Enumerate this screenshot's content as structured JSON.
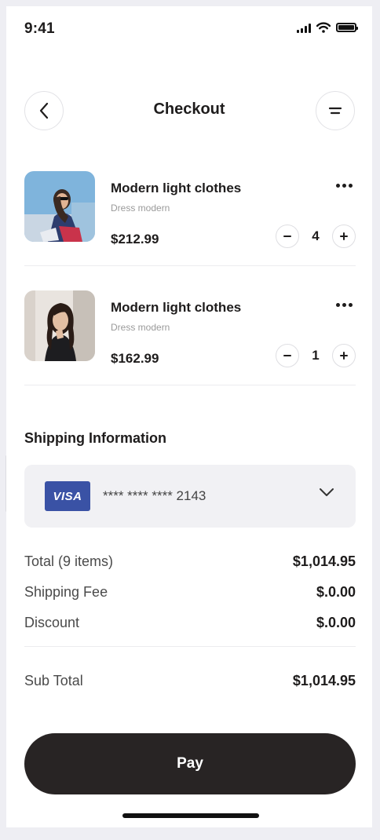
{
  "status_bar": {
    "time": "9:41"
  },
  "header": {
    "title": "Checkout"
  },
  "items": [
    {
      "name": "Modern light clothes",
      "subtitle": "Dress modern",
      "price": "$212.99",
      "quantity": "4"
    },
    {
      "name": "Modern light clothes",
      "subtitle": "Dress modern",
      "price": "$162.99",
      "quantity": "1"
    }
  ],
  "shipping": {
    "title": "Shipping Information",
    "card_brand": "VISA",
    "card_number": "**** **** **** 2143"
  },
  "summary": {
    "total_label": "Total (9 items)",
    "total_value": "$1,014.95",
    "shipping_label": "Shipping Fee",
    "shipping_value": "$.0.00",
    "discount_label": "Discount",
    "discount_value": "$.0.00",
    "subtotal_label": "Sub Total",
    "subtotal_value": "$1,014.95"
  },
  "pay_button": "Pay",
  "colors": {
    "primary_dark": "#282424",
    "visa_blue": "#3a52a5",
    "card_bg": "#f1f1f4"
  },
  "icons": [
    "signal-icon",
    "wifi-icon",
    "battery-icon",
    "back-arrow-icon",
    "menu-icon",
    "more-icon",
    "minus-icon",
    "plus-icon",
    "chevron-down-icon"
  ]
}
